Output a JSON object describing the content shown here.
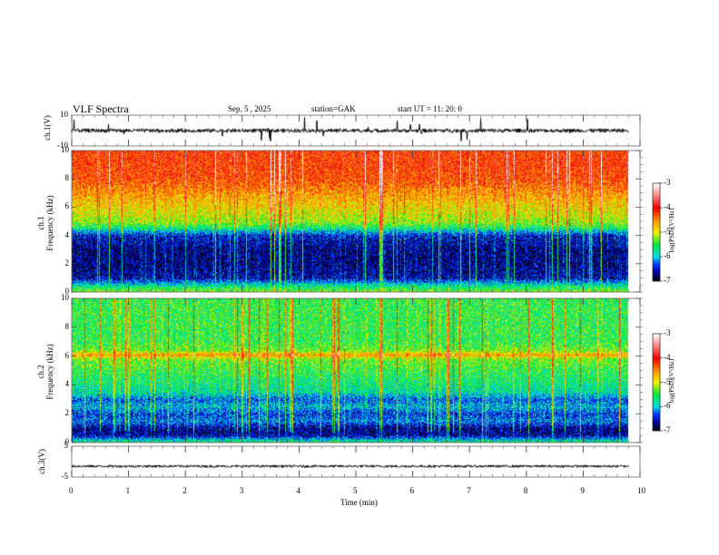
{
  "header": {
    "title": "VLF  Spectra",
    "date": "Sep. 5  , 2025",
    "station": "station=GAK",
    "start": "start  UT  =   11: 20: 0"
  },
  "chart_data": [
    {
      "type": "line",
      "name": "ch1 waveform",
      "ylabel": "ch.1(V)",
      "ylim": [
        -10,
        10
      ],
      "yticks": [
        "10",
        "-10"
      ],
      "baseline": 0
    },
    {
      "type": "heatmap",
      "name": "ch1 spectrogram",
      "ylabel": "ch.1\nFrequency (kHz)",
      "ylabel_lines": [
        "ch.1",
        "Frequency  (kHz)"
      ],
      "ylim": [
        0,
        10
      ],
      "yticks": [
        "0",
        "2",
        "4",
        "6",
        "8",
        "10"
      ],
      "profile_freq_khz": [
        0,
        0.5,
        1,
        2,
        3,
        4,
        4.6,
        5,
        6,
        7,
        8,
        9,
        10
      ],
      "profile_logpsd": [
        -5.2,
        -5.8,
        -6.6,
        -6.7,
        -6.7,
        -6.5,
        -5.6,
        -5.2,
        -4.9,
        -4.6,
        -4.3,
        -4.2,
        -4.2
      ],
      "colorbar": {
        "label": "log(PSD)(V²/Hz)",
        "range": [
          -7,
          -3
        ],
        "ticks": [
          "-3",
          "-4",
          "-5",
          "-6",
          "-7"
        ]
      }
    },
    {
      "type": "heatmap",
      "name": "ch2 spectrogram",
      "ylabel_lines": [
        "ch.2",
        "Frequency  (kHz)"
      ],
      "ylim": [
        0,
        10
      ],
      "yticks": [
        "0",
        "2",
        "4",
        "6",
        "8",
        "10"
      ],
      "profile_freq_khz": [
        0,
        0.5,
        1,
        1.5,
        2,
        2.5,
        3,
        3.5,
        4,
        5,
        5.8,
        6.1,
        6.4,
        7,
        8,
        9,
        10
      ],
      "profile_logpsd": [
        -5.5,
        -6.6,
        -6.7,
        -6.2,
        -6.4,
        -6.0,
        -6.3,
        -5.8,
        -5.7,
        -5.5,
        -5.3,
        -4.6,
        -5.3,
        -5.5,
        -5.5,
        -5.5,
        -5.5
      ],
      "colorbar": {
        "label": "log(PSD)(V²/Hz)",
        "range": [
          -7,
          -3
        ],
        "ticks": [
          "-3",
          "-4",
          "-5",
          "-6",
          "-7"
        ]
      }
    },
    {
      "type": "line",
      "name": "ch3 waveform",
      "ylabel": "ch.3(V)",
      "ylim": [
        -5,
        5
      ],
      "yticks": [
        "5",
        "-5"
      ],
      "baseline": -1.5
    }
  ],
  "xaxis": {
    "label": "Time  (min)",
    "range": [
      0,
      10
    ],
    "data_end": 9.8,
    "ticks": [
      "0",
      "1",
      "2",
      "3",
      "4",
      "5",
      "6",
      "7",
      "8",
      "9",
      "10"
    ]
  }
}
